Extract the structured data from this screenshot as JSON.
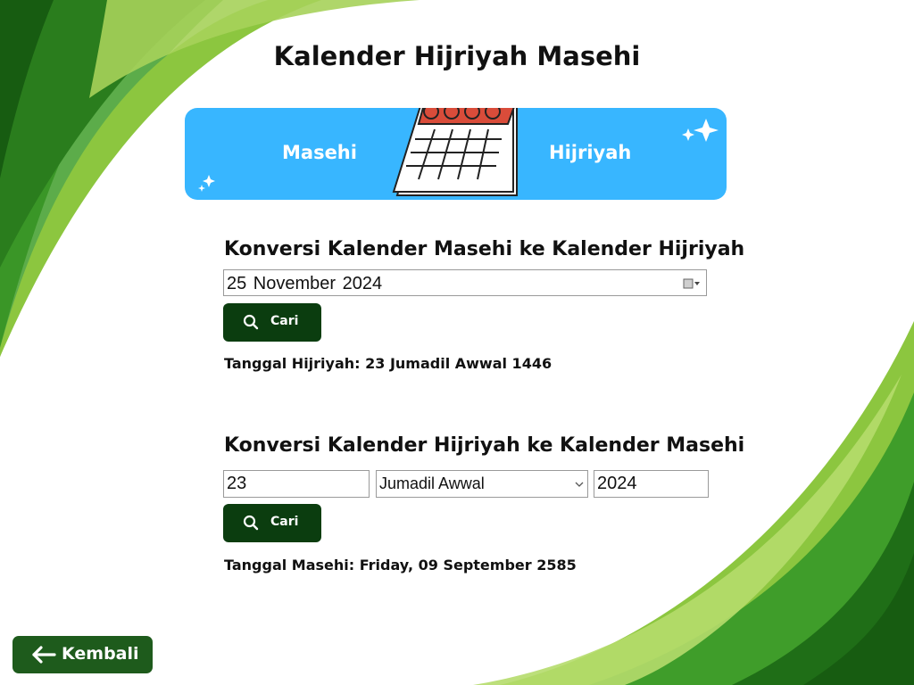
{
  "page": {
    "title": "Kalender Hijriyah Masehi"
  },
  "banner": {
    "left_label": "Masehi",
    "right_label": "Hijriyah",
    "color": "#38b6ff"
  },
  "gregorian_to_hijri": {
    "heading": "Konversi Kalender Masehi ke Kalender Hijriyah",
    "date_value": "25 November 2024",
    "search_label": "Cari",
    "result": "Tanggal Hijriyah: 23 Jumadil Awwal 1446"
  },
  "hijri_to_gregorian": {
    "heading": "Konversi Kalender Hijriyah ke Kalender Masehi",
    "day_value": "23",
    "month_value": "Jumadil Awwal",
    "year_value": "2024",
    "search_label": "Cari",
    "result": "Tanggal Masehi: Friday, 09 September 2585"
  },
  "nav": {
    "back_label": "Kembali"
  },
  "colors": {
    "button_dark_green": "#0b3d0f",
    "back_button_green": "#1e5b1c",
    "leaf_light": "#8cc63f",
    "leaf_dark": "#1f6e17"
  },
  "icons": [
    "search-icon",
    "calendar-icon",
    "sparkle-icon",
    "arrow-left-icon",
    "chevron-down-icon",
    "date-picker-icon"
  ]
}
